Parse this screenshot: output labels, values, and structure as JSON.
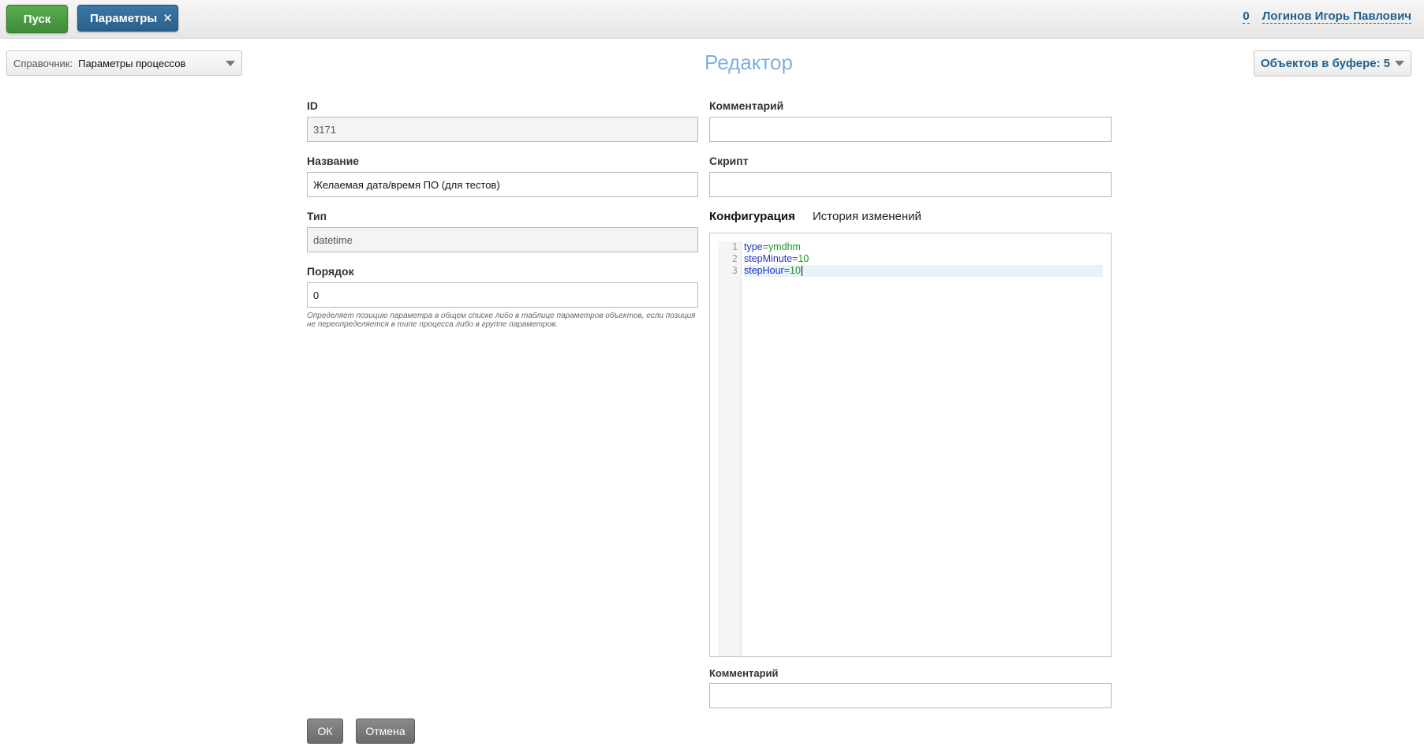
{
  "topbar": {
    "start_label": "Пуск",
    "tab_label": "Параметры",
    "tab_close": "✕",
    "count": "0",
    "user_name": "Логинов Игорь Павлович"
  },
  "toolbar": {
    "directory_label": "Справочник:",
    "directory_value": "Параметры процессов",
    "title": "Редактор",
    "buffer_label": "Объектов в буфере: 5"
  },
  "form": {
    "id_label": "ID",
    "id_value": "3171",
    "name_label": "Название",
    "name_value": "Желаемая дата/время ПО (для тестов)",
    "type_label": "Тип",
    "type_value": "datetime",
    "order_label": "Порядок",
    "order_value": "0",
    "order_hint": "Определяет позицию параметра в общем списке либо в таблице параметров объектов, если позиция не переопределяется в типе процесса либо в группе параметров.",
    "comment_label": "Комментарий",
    "comment_value": "",
    "script_label": "Скрипт",
    "script_value": ""
  },
  "config": {
    "tab_active": "Конфигурация",
    "tab_history": "История изменений",
    "lines": [
      {
        "num": "1",
        "key": "type",
        "op": "=",
        "value": "ymdhm"
      },
      {
        "num": "2",
        "key": "stepMinute",
        "op": "=",
        "value": "10"
      },
      {
        "num": "3",
        "key": "stepHour",
        "op": "=",
        "value": "10"
      }
    ]
  },
  "bottom": {
    "comment_label": "Комментарий",
    "comment_value": "",
    "ok_label": "ОК",
    "cancel_label": "Отмена"
  },
  "colors": {
    "start_button": "#4a9e42",
    "tab_button": "#2f6a98",
    "title": "#7fb1dd",
    "link": "#1f5f8f",
    "code_key": "#2030c8",
    "code_value": "#1a9a1a"
  }
}
